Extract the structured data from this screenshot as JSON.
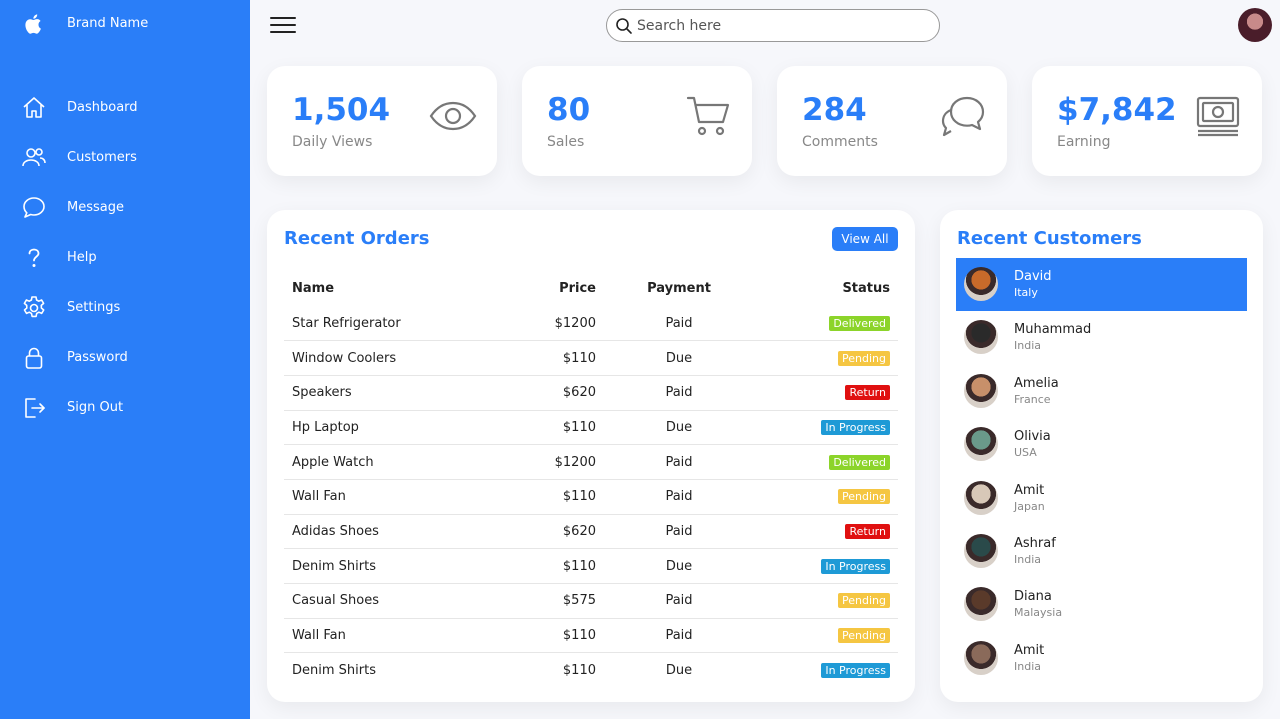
{
  "brand": {
    "name": "Brand Name",
    "logo_icon": "apple-icon"
  },
  "sidebar": {
    "items": [
      {
        "label": "Dashboard",
        "icon": "home-icon"
      },
      {
        "label": "Customers",
        "icon": "people-icon"
      },
      {
        "label": "Message",
        "icon": "chat-icon"
      },
      {
        "label": "Help",
        "icon": "help-icon"
      },
      {
        "label": "Settings",
        "icon": "gear-icon"
      },
      {
        "label": "Password",
        "icon": "lock-icon"
      },
      {
        "label": "Sign Out",
        "icon": "sign-out-icon"
      }
    ]
  },
  "topbar": {
    "search_placeholder": "Search here"
  },
  "cards": [
    {
      "value": "1,504",
      "label": "Daily Views",
      "icon": "eye-icon"
    },
    {
      "value": "80",
      "label": "Sales",
      "icon": "cart-icon"
    },
    {
      "value": "284",
      "label": "Comments",
      "icon": "comments-icon"
    },
    {
      "value": "$7,842",
      "label": "Earning",
      "icon": "cash-icon"
    }
  ],
  "orders": {
    "title": "Recent Orders",
    "view_all": "View All",
    "headers": {
      "name": "Name",
      "price": "Price",
      "payment": "Payment",
      "status": "Status"
    },
    "rows": [
      {
        "name": "Star Refrigerator",
        "price": "$1200",
        "payment": "Paid",
        "status": "Delivered"
      },
      {
        "name": "Window Coolers",
        "price": "$110",
        "payment": "Due",
        "status": "Pending"
      },
      {
        "name": "Speakers",
        "price": "$620",
        "payment": "Paid",
        "status": "Return"
      },
      {
        "name": "Hp Laptop",
        "price": "$110",
        "payment": "Due",
        "status": "In Progress"
      },
      {
        "name": "Apple Watch",
        "price": "$1200",
        "payment": "Paid",
        "status": "Delivered"
      },
      {
        "name": "Wall Fan",
        "price": "$110",
        "payment": "Paid",
        "status": "Pending"
      },
      {
        "name": "Adidas Shoes",
        "price": "$620",
        "payment": "Paid",
        "status": "Return"
      },
      {
        "name": "Denim Shirts",
        "price": "$110",
        "payment": "Due",
        "status": "In Progress"
      },
      {
        "name": "Casual Shoes",
        "price": "$575",
        "payment": "Paid",
        "status": "Pending"
      },
      {
        "name": "Wall Fan",
        "price": "$110",
        "payment": "Paid",
        "status": "Pending"
      },
      {
        "name": "Denim Shirts",
        "price": "$110",
        "payment": "Due",
        "status": "In Progress"
      }
    ],
    "status_colors": {
      "Delivered": "#8cd42a",
      "Pending": "#f5c642",
      "Return": "#e01010",
      "In Progress": "#1e9ad6"
    }
  },
  "customers": {
    "title": "Recent Customers",
    "items": [
      {
        "name": "David",
        "country": "Italy",
        "active": true,
        "avatar_color": "#c86a2a"
      },
      {
        "name": "Muhammad",
        "country": "India",
        "active": false,
        "avatar_color": "#2a2a2a"
      },
      {
        "name": "Amelia",
        "country": "France",
        "active": false,
        "avatar_color": "#c8906a"
      },
      {
        "name": "Olivia",
        "country": "USA",
        "active": false,
        "avatar_color": "#6a9a8a"
      },
      {
        "name": "Amit",
        "country": "Japan",
        "active": false,
        "avatar_color": "#d8c8b8"
      },
      {
        "name": "Ashraf",
        "country": "India",
        "active": false,
        "avatar_color": "#2a4a4a"
      },
      {
        "name": "Diana",
        "country": "Malaysia",
        "active": false,
        "avatar_color": "#5a3a2a"
      },
      {
        "name": "Amit",
        "country": "India",
        "active": false,
        "avatar_color": "#8a6a5a"
      }
    ]
  },
  "colors": {
    "accent": "#2a7ef8"
  }
}
